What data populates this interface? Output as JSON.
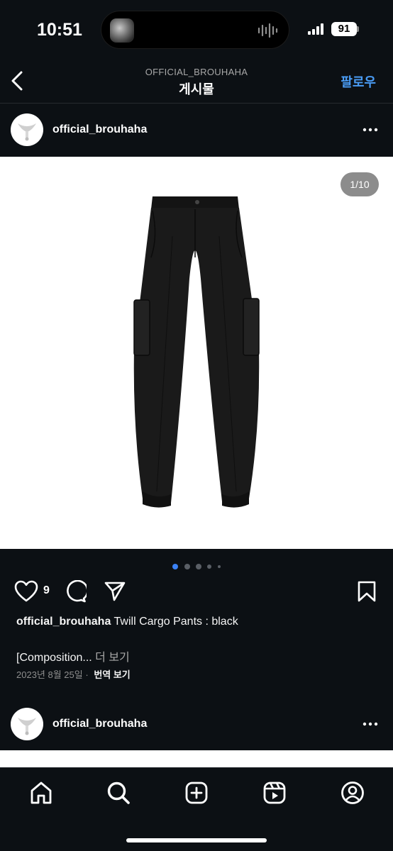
{
  "status_bar": {
    "time": "10:51",
    "battery": "91"
  },
  "header": {
    "account": "OFFICIAL_BROUHAHA",
    "title": "게시물",
    "follow_label": "팔로우"
  },
  "post": {
    "username": "official_brouhaha",
    "image_counter": "1/10",
    "image_alt": "Twill Cargo Pants black",
    "likes": "9",
    "caption_user": "official_brouhaha",
    "caption_text": "Twill Cargo Pants : black",
    "caption_line2": "[Composition...",
    "more_label": "더 보기",
    "date": "2023년 8월 25일",
    "separator": "·",
    "translate_label": "번역 보기"
  },
  "next_post": {
    "username": "official_brouhaha"
  },
  "icons": {
    "back": "chevron-left-icon",
    "more": "more-horizontal-icon",
    "like": "heart-icon",
    "comment": "comment-icon",
    "share": "send-icon",
    "save": "bookmark-icon",
    "home": "home-icon",
    "search": "search-icon",
    "create": "plus-square-icon",
    "reels": "reels-icon",
    "profile": "profile-icon"
  },
  "colors": {
    "background": "#0c1014",
    "accent": "#4a9cf5",
    "active_dot": "#3b82f6"
  }
}
